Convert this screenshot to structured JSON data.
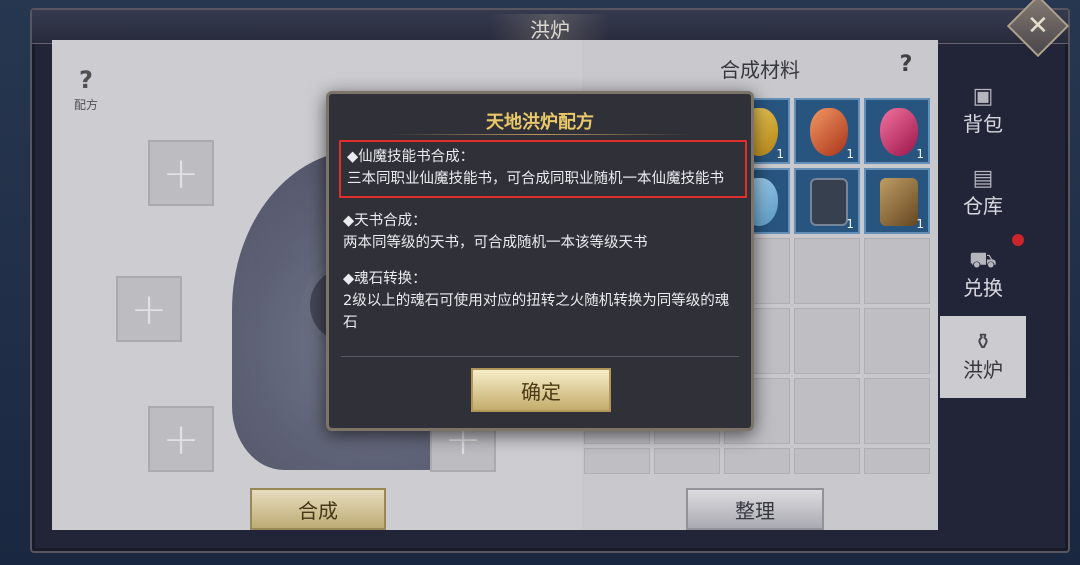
{
  "window": {
    "title": "洪炉",
    "close_icon": "close-icon"
  },
  "left_panel": {
    "help_mark": "?",
    "recipe_label": "配方",
    "slot_symbol": "+",
    "compose_button": "合成"
  },
  "right_panel": {
    "header": "合成材料",
    "help_mark": "?",
    "organize_button": "整理",
    "items": [
      {
        "icon": "yellow-gem-icon",
        "count": "1"
      },
      {
        "icon": "red-gem-icon",
        "count": "1"
      },
      {
        "icon": "pink-gem-icon",
        "count": "1"
      },
      {
        "icon": "blue-crystal-icon",
        "count": ""
      },
      {
        "icon": "dark-rune-icon",
        "count": "1"
      },
      {
        "icon": "ore-icon",
        "count": "1"
      }
    ]
  },
  "tabs": [
    {
      "label": "背包",
      "icon": "bag-icon"
    },
    {
      "label": "仓库",
      "icon": "warehouse-icon"
    },
    {
      "label": "兑换",
      "icon": "cart-icon"
    },
    {
      "label": "洪炉",
      "icon": "furnace-icon"
    }
  ],
  "modal": {
    "title": "天地洪炉配方",
    "rules": [
      {
        "name": "◆仙魔技能书合成：",
        "desc": "三本同职业仙魔技能书，可合成同职业随机一本仙魔技能书"
      },
      {
        "name": "◆天书合成：",
        "desc": "两本同等级的天书，可合成随机一本该等级天书"
      },
      {
        "name": "◆魂石转换：",
        "desc": "2级以上的魂石可使用对应的扭转之火随机转换为同等级的魂石"
      }
    ],
    "confirm_button": "确定"
  },
  "colors": {
    "accent_gold": "#e9c86a",
    "highlight_red": "#e02e2a",
    "notify_dot": "#d8262c"
  }
}
